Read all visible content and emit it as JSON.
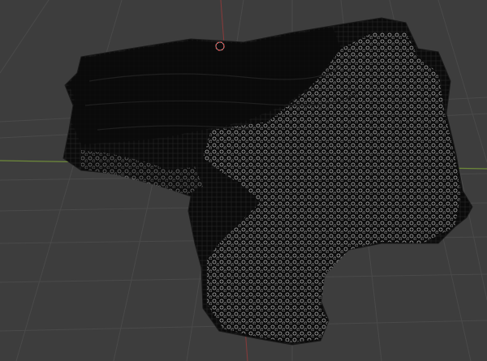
{
  "viewport": {
    "mode": "3D Viewport",
    "background_color": "#3d3d3d",
    "grid_color": "#4a4a4a",
    "x_axis_color": "#8a3a3a",
    "y_axis_color": "#6e8a3a",
    "z_axis_color": "#8a3a3a",
    "mesh_color": "#0c0c0c",
    "wire_color": "#c8c8c8",
    "cursor_color": "#e05050",
    "object": "scanned-mesh",
    "shading": "wireframe-overlay"
  }
}
